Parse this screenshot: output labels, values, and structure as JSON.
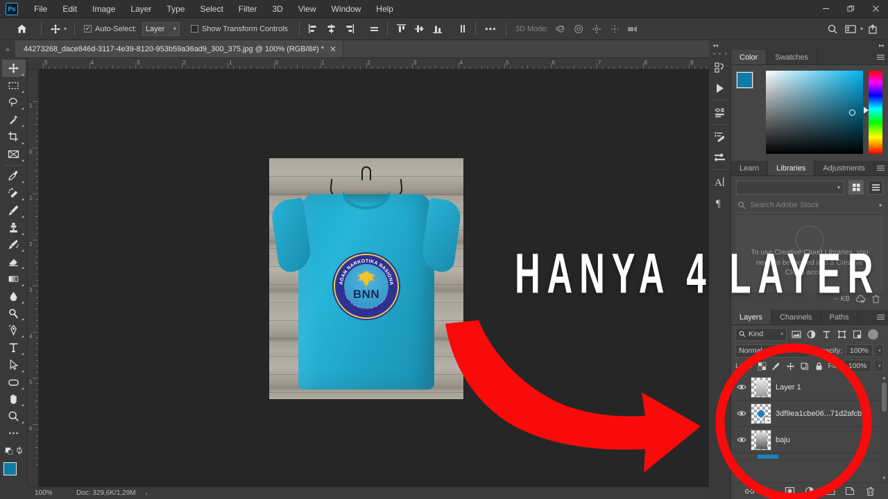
{
  "app": {
    "logo_text": "Ps",
    "menu": [
      "File",
      "Edit",
      "Image",
      "Layer",
      "Type",
      "Select",
      "Filter",
      "3D",
      "View",
      "Window",
      "Help"
    ],
    "window_controls": {
      "minimize": "–",
      "restore": "❐",
      "close": "✕"
    }
  },
  "options_bar": {
    "home_icon": "home-icon",
    "tool_icon": "move-tool-icon",
    "autoselect_label": "Auto-Select:",
    "autoselect_checked": true,
    "autoselect_scope": "Layer",
    "transform_label": "Show Transform Controls",
    "transform_checked": false,
    "align_left_label": "align-left",
    "align_hcenter_label": "align-horizontal-center",
    "align_right_label": "align-right",
    "distribute_label": "distribute-horizontal",
    "align_top_label": "align-top",
    "align_vcenter_label": "align-vertical-center",
    "align_bottom_label": "align-bottom",
    "distribute_v_label": "distribute-vertical",
    "more_label": "•••",
    "mode3d_label": "3D Mode:",
    "search_icon": "search-icon",
    "workspace_icon": "workspace-icon",
    "share_icon": "share-icon"
  },
  "document": {
    "tab_title": "44273268_dace846d-3117-4e39-8120-953b59a36ad9_300_375.jpg @ 100% (RGB/8#) *",
    "close_glyph": "✕",
    "collapse_glyph": "»"
  },
  "toolbar": {
    "tools": [
      {
        "name": "move-tool",
        "glyph": "move",
        "active": true
      },
      {
        "name": "rectangular-marquee-tool",
        "glyph": "marquee",
        "active": false
      },
      {
        "name": "lasso-tool",
        "glyph": "lasso",
        "active": false
      },
      {
        "name": "quick-selection-tool",
        "glyph": "wand",
        "active": false
      },
      {
        "name": "crop-tool",
        "glyph": "crop",
        "active": false
      },
      {
        "name": "frame-tool",
        "glyph": "frame",
        "active": false
      },
      {
        "name": "eyedropper-tool",
        "glyph": "eyedropper",
        "active": false
      },
      {
        "name": "spot-healing-brush-tool",
        "glyph": "healing",
        "active": false
      },
      {
        "name": "brush-tool",
        "glyph": "brush",
        "active": false
      },
      {
        "name": "clone-stamp-tool",
        "glyph": "stamp",
        "active": false
      },
      {
        "name": "history-brush-tool",
        "glyph": "history-brush",
        "active": false
      },
      {
        "name": "eraser-tool",
        "glyph": "eraser",
        "active": false
      },
      {
        "name": "gradient-tool",
        "glyph": "gradient",
        "active": false
      },
      {
        "name": "blur-tool",
        "glyph": "blur",
        "active": false
      },
      {
        "name": "dodge-tool",
        "glyph": "dodge",
        "active": false
      },
      {
        "name": "pen-tool",
        "glyph": "pen",
        "active": false
      },
      {
        "name": "type-tool",
        "glyph": "T",
        "active": false
      },
      {
        "name": "path-selection-tool",
        "glyph": "arrow",
        "active": false
      },
      {
        "name": "rectangle-tool",
        "glyph": "rectangle",
        "active": false
      },
      {
        "name": "hand-tool",
        "glyph": "hand",
        "active": false
      },
      {
        "name": "zoom-tool",
        "glyph": "zoom",
        "active": false
      },
      {
        "name": "edit-toolbar",
        "glyph": "dots",
        "active": false
      }
    ],
    "foreground_color": "#0f7ba5",
    "background_color": "#f2dd3f",
    "quick-mask": "quick-mask-icon"
  },
  "rulers": {
    "horizontal": [
      "5",
      "4",
      "3",
      "2",
      "1",
      "0",
      "1",
      "2",
      "3",
      "4",
      "5",
      "6",
      "7",
      "8",
      "9"
    ],
    "vertical": [
      "1",
      "0",
      "1",
      "2",
      "3",
      "4",
      "5",
      "6"
    ],
    "unit": "inches"
  },
  "canvas": {
    "artwork_alt": "Blue t-shirt with BNN logo on wooden plank background",
    "logo_top_text": "BADAN NARKOTIKA NASIONAL",
    "logo_bottom_text": "REPUBLIK INDONESIA",
    "logo_center_text": "BNN",
    "shirt_color": "#22aace",
    "overlay_text": "HANYA 4 LAYER",
    "annotation_color": "#fa0a0a",
    "arrow_name": "red-curved-arrow",
    "ellipse_name": "red-highlight-ellipse"
  },
  "right_rail": {
    "icons": [
      {
        "name": "history-panel-icon"
      },
      {
        "name": "actions-panel-icon"
      },
      {
        "name": "3d-panel-icon"
      },
      {
        "name": "brush-settings-icon"
      },
      {
        "name": "brush-presets-icon"
      },
      {
        "name": "character-panel-icon"
      },
      {
        "name": "paragraph-panel-icon"
      }
    ],
    "collapse_left": "◂◂",
    "collapse_right": "▸▸"
  },
  "color_panel": {
    "tabs": [
      {
        "label": "Color",
        "active": true
      },
      {
        "label": "Swatches",
        "active": false
      }
    ],
    "foreground_color": "#0f7ba5",
    "background_color": "#f2dd3f",
    "menu_icon": "panel-menu-icon"
  },
  "libraries_panel": {
    "tabs": [
      {
        "label": "Learn",
        "active": false
      },
      {
        "label": "Libraries",
        "active": true
      },
      {
        "label": "Adjustments",
        "active": false
      }
    ],
    "library_select_value": "",
    "search_placeholder": "Search Adobe Stock",
    "empty_message": "To use Creative Cloud Libraries, you need to be logged into a Creative Cloud account.",
    "size_label": "-- KB",
    "sync_icon": "cloud-off-icon",
    "delete_icon": "trash-icon",
    "grid_view_icon": "grid-view-icon",
    "list_view_icon": "list-view-icon",
    "menu_icon": "panel-menu-icon"
  },
  "layers_panel": {
    "tabs": [
      {
        "label": "Layers",
        "active": true
      },
      {
        "label": "Channels",
        "active": false
      },
      {
        "label": "Paths",
        "active": false
      }
    ],
    "filter_label": "Kind",
    "filter_icons": [
      "pixel-filter-icon",
      "adjustment-filter-icon",
      "type-filter-icon",
      "shape-filter-icon",
      "smart-object-filter-icon"
    ],
    "blend_mode": "Normal",
    "opacity_label": "Opacity:",
    "opacity_value": "100%",
    "lock_label": "Lock:",
    "fill_label": "Fill:",
    "fill_value": "100%",
    "lock_icons": [
      "lock-transparent-icon",
      "lock-image-icon",
      "lock-position-icon",
      "lock-artboard-icon",
      "lock-all-icon"
    ],
    "layers": [
      {
        "name": "Layer 1",
        "visible": true,
        "thumb": "shirt-light",
        "badge": ""
      },
      {
        "name": "3df9ea1cbe06...71d2afcb1e",
        "visible": true,
        "thumb": "logo-blue",
        "badge": "smart-object"
      },
      {
        "name": "baju",
        "visible": true,
        "thumb": "shirt-dark",
        "badge": ""
      }
    ],
    "footer_icons": [
      {
        "name": "link-layers-icon",
        "glyph": "⚭"
      },
      {
        "name": "layer-style-icon",
        "glyph": "fx"
      },
      {
        "name": "layer-mask-icon",
        "glyph": "mask"
      },
      {
        "name": "adjustment-layer-icon",
        "glyph": "halfcircle"
      },
      {
        "name": "new-group-icon",
        "glyph": "folder"
      },
      {
        "name": "new-layer-icon",
        "glyph": "newlayer"
      },
      {
        "name": "delete-layer-icon",
        "glyph": "trash"
      }
    ],
    "menu_icon": "panel-menu-icon"
  },
  "status_bar": {
    "zoom": "100%",
    "doc_info": "Doc: 329,6K/1,29M",
    "expand_glyph": "›"
  }
}
